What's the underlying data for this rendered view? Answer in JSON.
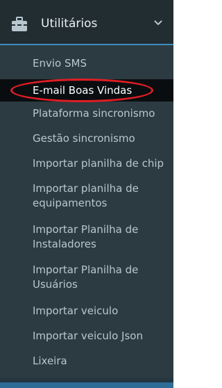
{
  "menu": {
    "title": "Utilitários",
    "icon": "toolbox-icon",
    "expand_icon": "chevron-down-icon",
    "items": [
      {
        "label": "Envio SMS",
        "active": false
      },
      {
        "label": "E-mail Boas Vindas",
        "active": true
      },
      {
        "label": "Plataforma sincronismo",
        "active": false
      },
      {
        "label": "Gestão sincronismo",
        "active": false
      },
      {
        "label": "Importar planilha de chip",
        "active": false
      },
      {
        "label": "Importar planilha de",
        "label2": "equipamentos",
        "active": false
      },
      {
        "label": "Importar Planilha de",
        "label2": "Instaladores",
        "active": false
      },
      {
        "label": "Importar Planilha de",
        "label2": "Usuários",
        "active": false
      },
      {
        "label": "Importar veiculo",
        "active": false
      },
      {
        "label": "Importar veiculo Json",
        "active": false
      },
      {
        "label": "Lixeira",
        "active": false
      }
    ]
  },
  "colors": {
    "header_bg": "#222d32",
    "submenu_bg": "#2c3b41",
    "active_bg": "#0a0d0f",
    "item_text": "#b8c7ce",
    "annotation": "#e21d24"
  }
}
